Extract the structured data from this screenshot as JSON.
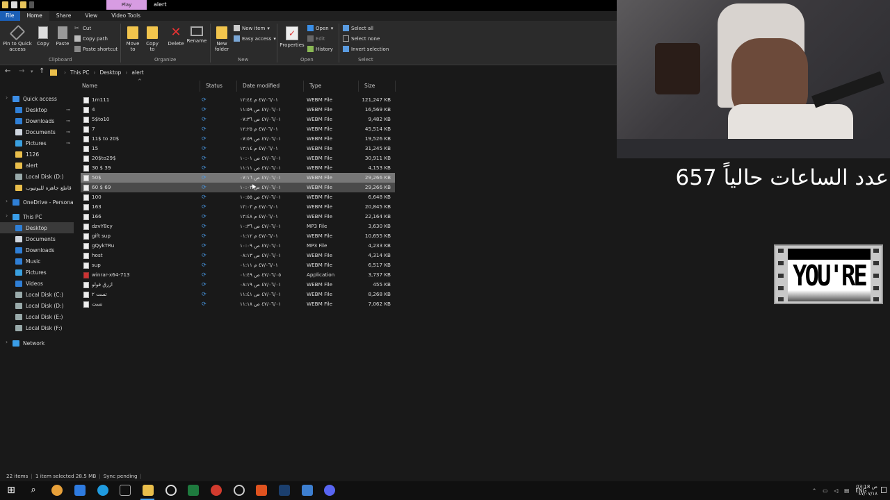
{
  "window": {
    "title": "alert",
    "context_tab": "Play"
  },
  "ribbon_tabs": [
    "File",
    "Home",
    "Share",
    "View",
    "Video Tools"
  ],
  "ribbon": {
    "clipboard": {
      "pin": "Pin to Quick access",
      "copy": "Copy",
      "paste": "Paste",
      "cut": "Cut",
      "copy_path": "Copy path",
      "paste_shortcut": "Paste shortcut",
      "label": "Clipboard"
    },
    "organize": {
      "move_to": "Move to",
      "copy_to": "Copy to",
      "delete": "Delete",
      "rename": "Rename",
      "label": "Organize"
    },
    "new": {
      "new_folder": "New folder",
      "new_item": "New item",
      "easy_access": "Easy access",
      "label": "New"
    },
    "open": {
      "properties": "Properties",
      "open": "Open",
      "edit": "Edit",
      "history": "History",
      "label": "Open"
    },
    "select": {
      "select_all": "Select all",
      "select_none": "Select none",
      "invert": "Invert selection",
      "label": "Select"
    }
  },
  "address": {
    "crumbs": [
      "This PC",
      "Desktop",
      "alert"
    ]
  },
  "sidebar": {
    "items": [
      {
        "label": "Quick access",
        "icon": "star-icon",
        "color": "#3d8ee6"
      },
      {
        "label": "Desktop",
        "icon": "desktop-icon",
        "color": "#2f7fd6",
        "pinned": true
      },
      {
        "label": "Downloads",
        "icon": "download-icon",
        "color": "#2f7fd6",
        "pinned": true
      },
      {
        "label": "Documents",
        "icon": "documents-icon",
        "color": "#cfd6df",
        "pinned": true
      },
      {
        "label": "Pictures",
        "icon": "pictures-icon",
        "color": "#3aa0e0",
        "pinned": true
      },
      {
        "label": "1126",
        "icon": "folder-icon",
        "color": "#e9be4b"
      },
      {
        "label": "alert",
        "icon": "folder-icon",
        "color": "#e9be4b"
      },
      {
        "label": "Local Disk (D:)",
        "icon": "drive-icon",
        "color": "#9aa"
      },
      {
        "label": "قاطع جاهزه لليوتيوب",
        "icon": "folder-icon",
        "color": "#e9be4b"
      },
      {
        "label": "OneDrive - Personal",
        "icon": "cloud-icon",
        "color": "#2f7fd6"
      },
      {
        "label": "This PC",
        "icon": "pc-icon",
        "color": "#3a9ee8"
      },
      {
        "label": "Desktop",
        "icon": "desktop-icon",
        "color": "#2f7fd6",
        "selected": true
      },
      {
        "label": "Documents",
        "icon": "documents-icon",
        "color": "#cfd6df"
      },
      {
        "label": "Downloads",
        "icon": "download-icon",
        "color": "#2f7fd6"
      },
      {
        "label": "Music",
        "icon": "music-icon",
        "color": "#2f7fd6"
      },
      {
        "label": "Pictures",
        "icon": "pictures-icon",
        "color": "#3aa0e0"
      },
      {
        "label": "Videos",
        "icon": "videos-icon",
        "color": "#2f7fd6"
      },
      {
        "label": "Local Disk (C:)",
        "icon": "drive-icon",
        "color": "#9aa"
      },
      {
        "label": "Local Disk (D:)",
        "icon": "drive-icon",
        "color": "#9aa"
      },
      {
        "label": "Local Disk (E:)",
        "icon": "drive-icon",
        "color": "#9aa"
      },
      {
        "label": "Local Disk (F:)",
        "icon": "drive-icon",
        "color": "#9aa"
      },
      {
        "label": "Network",
        "icon": "network-icon",
        "color": "#3a9ee8"
      }
    ]
  },
  "columns": [
    "Name",
    "Status",
    "Date modified",
    "Type",
    "Size"
  ],
  "files": [
    {
      "name": "1m111",
      "date": "٤٧/٠٦/٠١ م ١٢:٤٤",
      "type": "WEBM File",
      "size": "121,247 KB"
    },
    {
      "name": "4",
      "date": "٤٧/٠٦/٠١ ص ١١:٥٩",
      "type": "WEBM File",
      "size": "16,569 KB"
    },
    {
      "name": "5$to10",
      "date": "٤٧/٠٦/٠١ ص ٠٧:٣٦",
      "type": "WEBM File",
      "size": "9,482 KB"
    },
    {
      "name": "7",
      "date": "٤٧/٠٦/٠١ م ١٢:٢٥",
      "type": "WEBM File",
      "size": "45,514 KB"
    },
    {
      "name": "11$ to 20$",
      "date": "٤٧/٠٦/٠١ ص ٠٧:٥٩",
      "type": "WEBM File",
      "size": "19,526 KB"
    },
    {
      "name": "15",
      "date": "٤٧/٠٦/٠١ م ١٢:١٤",
      "type": "WEBM File",
      "size": "31,245 KB"
    },
    {
      "name": "20$to29$",
      "date": "٤٧/٠٦/٠١ ص ١٠:٠١",
      "type": "WEBM File",
      "size": "30,911 KB"
    },
    {
      "name": "30 $ 39",
      "date": "٤٧/٠٦/٠١ ص ١١:١١",
      "type": "WEBM File",
      "size": "4,153 KB"
    },
    {
      "name": "50$",
      "date": "٤٧/٠٦/٠١ ص ٠٧:١٦",
      "type": "WEBM File",
      "size": "29,266 KB",
      "state": "selected"
    },
    {
      "name": "60 $ 69",
      "date": "٤٧/٠٦/٠١ ص ١٠:٠٣",
      "type": "WEBM File",
      "size": "29,266 KB",
      "state": "hover"
    },
    {
      "name": "100",
      "date": "٤٧/٠٦/٠١ ص ١٠:٥٥",
      "type": "WEBM File",
      "size": "6,648 KB"
    },
    {
      "name": "163",
      "date": "٤٧/٠٦/٠١ م ١٢:٠٣",
      "type": "WEBM File",
      "size": "20,845 KB"
    },
    {
      "name": "166",
      "date": "٤٧/٠٦/٠١ م ١٢:٤٨",
      "type": "WEBM File",
      "size": "22,164 KB"
    },
    {
      "name": "dzvY8cy",
      "date": "٤٧/٠٦/٠١ ص ١٠:٣٦",
      "type": "MP3 File",
      "size": "3,630 KB"
    },
    {
      "name": "gift sup",
      "date": "٤٧/٠٦/٠١ م ٠١:١٢",
      "type": "WEBM File",
      "size": "10,655 KB"
    },
    {
      "name": "gQykTRu",
      "date": "٤٧/٠٦/٠١ ص ١٠:٠٩",
      "type": "MP3 File",
      "size": "4,233 KB"
    },
    {
      "name": "host",
      "date": "٤٧/٠٦/٠١ ص ٠٨:١٣",
      "type": "WEBM File",
      "size": "4,314 KB"
    },
    {
      "name": "sup",
      "date": "٤٧/٠٦/٠١ م ٠١:١١",
      "type": "WEBM File",
      "size": "6,517 KB"
    },
    {
      "name": "winrar-x64-713",
      "date": "٤٧/٠٦/٠٥ ص ٠١:٤٩",
      "type": "Application",
      "size": "3,737 KB",
      "app": true
    },
    {
      "name": "ازرق فولو",
      "date": "٤٧/٠٦/٠١ ص ٠٨:١٩",
      "type": "WEBM File",
      "size": "455 KB"
    },
    {
      "name": "تست ٢",
      "date": "٤٧/٠٦/٠١ ص ١١:٤١",
      "type": "WEBM File",
      "size": "8,268 KB"
    },
    {
      "name": "تست",
      "date": "٤٧/٠٦/٠١ ص ١١:١٨",
      "type": "WEBM File",
      "size": "7,062 KB"
    }
  ],
  "status": {
    "items": "22 items",
    "selected": "1 item selected  28.5 MB",
    "sync": "Sync pending"
  },
  "tray": {
    "lang": "ENG",
    "time": "03:18 ص",
    "date": "٤٧/٠٧/١٨"
  },
  "overlay": {
    "hours_text": "عدد الساعات حالياً 657",
    "film_text": "YOU'RE"
  }
}
